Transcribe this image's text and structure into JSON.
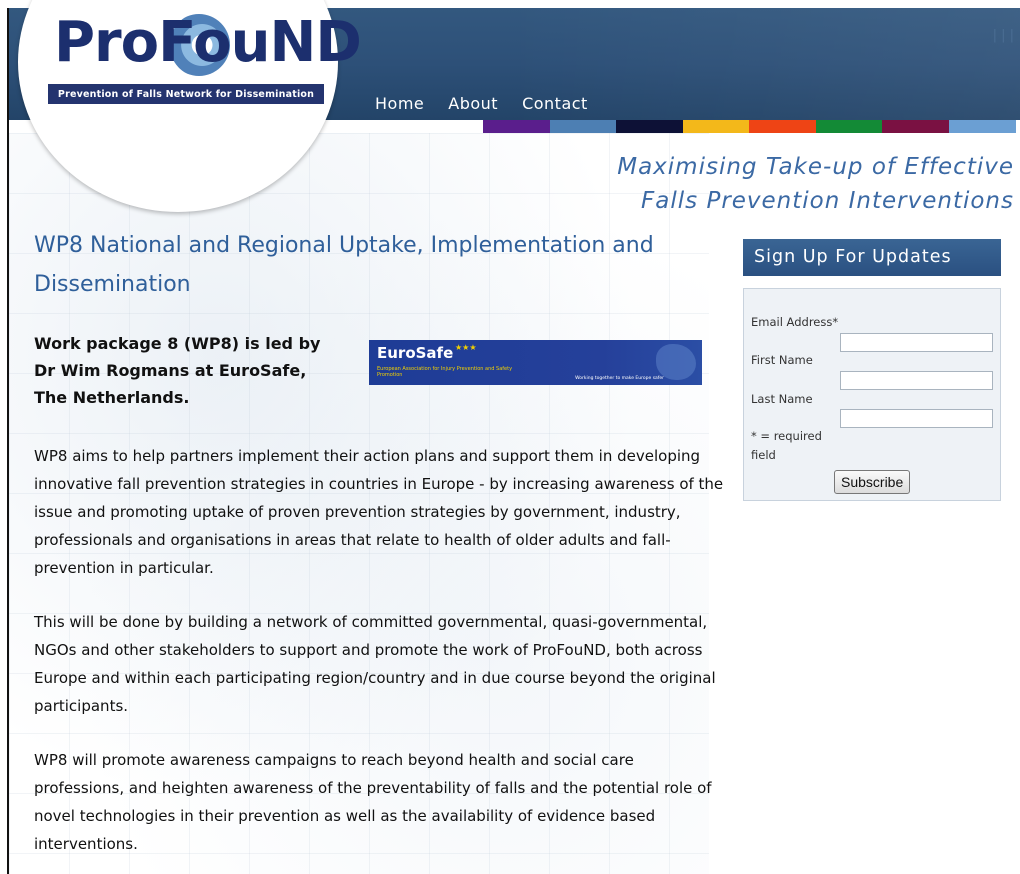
{
  "page_title_top": "ng",
  "header": {
    "logo_word": "ProFouND",
    "logo_tagline": "Prevention of Falls Network for Dissemination",
    "corner_text": "| | |",
    "nav": [
      {
        "label": "Home"
      },
      {
        "label": "About"
      },
      {
        "label": "Contact"
      }
    ],
    "stripe_colors": [
      "#5a1e8c",
      "#4d7fb3",
      "#0d1136",
      "#f3b81a",
      "#ee4415",
      "#138a36",
      "#7a1142",
      "#6b9fd3"
    ]
  },
  "tagline": {
    "line1": "Maximising Take-up of Effective",
    "line2": "Falls Prevention Interventions"
  },
  "main": {
    "heading": "WP8 National and Regional Uptake, Implementation and Dissemination",
    "lead": "Work package 8 (WP8) is led by Dr Wim Rogmans at EuroSafe, The Netherlands.",
    "logo": {
      "name": "EuroSafe",
      "subtitle": "European Association for Injury Prevention and Safety Promotion",
      "motto": "Working together to make Europe safer"
    },
    "paragraphs": [
      "WP8 aims to help partners implement their action plans and support them in developing innovative fall prevention strategies in countries in Europe - by increasing awareness of the issue and promoting uptake of proven prevention strategies by government, industry, professionals and organisations in areas that relate to health of older adults and fall-prevention in particular.",
      "This will be done by building a network of committed governmental, quasi-governmental, NGOs and other stakeholders to support and promote the work of ProFouND, both across Europe and within each participating region/country and in due course beyond the original participants.",
      "WP8 will promote awareness campaigns to reach beyond health and social care professions, and heighten awareness of the preventability of falls and the potential role of novel technologies in their prevention as well as the availability of evidence based interventions."
    ]
  },
  "signup": {
    "title": "Sign Up For Updates",
    "email_label": "Email Address*",
    "first_name_label": "First Name",
    "last_name_label": "Last Name",
    "required_note": "* = required field",
    "subscribe_label": "Subscribe"
  }
}
